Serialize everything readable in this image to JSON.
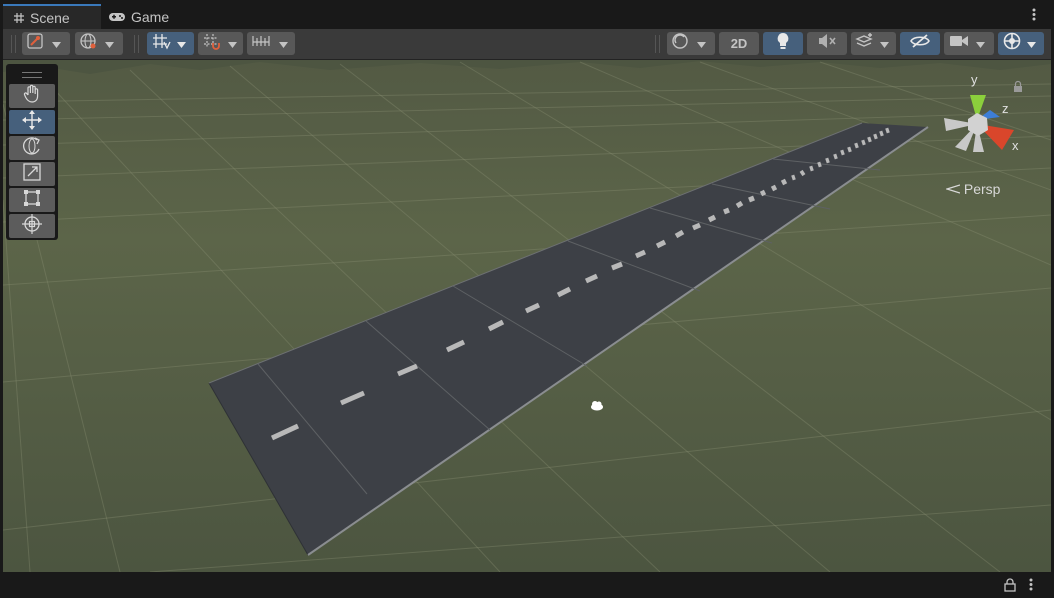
{
  "tabs": [
    {
      "label": "Scene",
      "icon": "scene-grid-icon",
      "active": true
    },
    {
      "label": "Game",
      "icon": "gamepad-icon",
      "active": false
    }
  ],
  "toolbar": {
    "left": [
      "gizmo-orient-icon",
      "global-icon",
      "grid-snap-icon",
      "increment-snap-icon",
      "ruler-icon"
    ],
    "right": {
      "draw_mode_icon": "shading-mode-icon",
      "mode_2d_label": "2D",
      "lighting_icon": "lightbulb-icon",
      "audio_icon": "audio-mute-icon",
      "effects_icon": "effects-icon",
      "visibility_icon": "visibility-hidden-icon",
      "camera_icon": "camera-icon",
      "gizmos_icon": "gizmos-icon"
    }
  },
  "tools": [
    {
      "name": "hand-tool-icon",
      "active": false
    },
    {
      "name": "move-tool-icon",
      "active": true
    },
    {
      "name": "rotate-tool-icon",
      "active": false
    },
    {
      "name": "scale-tool-icon",
      "active": false
    },
    {
      "name": "rect-tool-icon",
      "active": false
    },
    {
      "name": "transform-tool-icon",
      "active": false
    }
  ],
  "gizmo": {
    "y": "y",
    "z": "z",
    "x": "x",
    "projection": "Persp"
  },
  "colors": {
    "ground": "#5a6348",
    "road": "#3c3f45",
    "accent": "#3a79bb",
    "active_button": "#46607c",
    "axis_x": "#d9462b",
    "axis_y": "#8bcf3c",
    "axis_z": "#3d7ed6"
  }
}
